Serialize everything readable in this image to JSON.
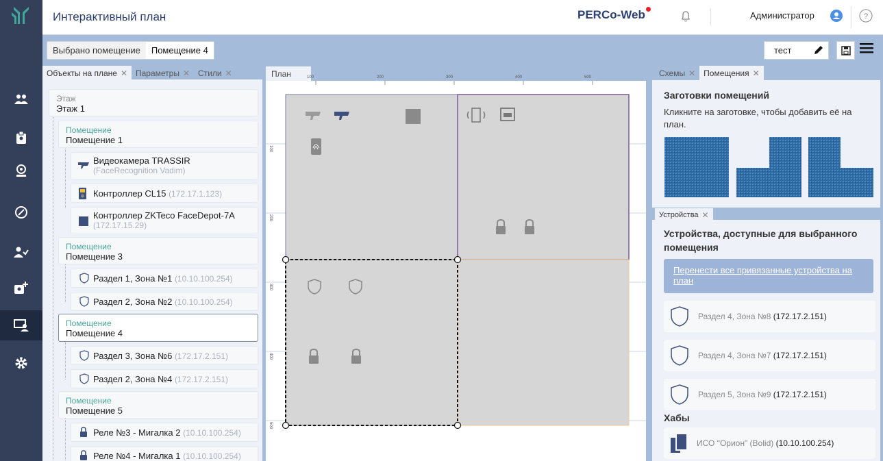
{
  "header": {
    "title": "Интерактивный план",
    "brand": "PERCo-Web",
    "user": "Администратор"
  },
  "toolbar": {
    "selected_label": "Выбрано помещение",
    "selected_value": "Помещение 4",
    "scheme_value": "тест"
  },
  "left_tabs": [
    "Объекты на плане",
    "Параметры",
    "Стили"
  ],
  "tree": {
    "floor_label": "Этаж",
    "floor_name": "Этаж 1",
    "room_label": "Помещение",
    "room1": "Помещение 1",
    "cam_name": "Видеокамера TRASSIR",
    "cam_sub": "(FaceRecognition Vadim)",
    "ctrl1_name": "Контроллер CL15",
    "ctrl1_ip": "(172.17.1.123)",
    "ctrl2_name": "Контроллер ZKTeco FaceDepot-7A",
    "ctrl2_ip": "(172.17.15.29)",
    "room3": "Помещение 3",
    "z1_name": "Раздел 1, Зона №1",
    "z1_ip": "(10.10.100.254)",
    "z2_name": "Раздел 2, Зона №2",
    "z2_ip": "(10.10.100.254)",
    "room4": "Помещение 4",
    "z6_name": "Раздел 3, Зона №6",
    "z6_ip": "(172.17.2.151)",
    "z4_name": "Раздел 2, Зона №4",
    "z4_ip": "(172.17.2.151)",
    "room5": "Помещение 5",
    "r3_name": "Реле №3 - Мигалка 2",
    "r3_ip": "(10.10.100.254)",
    "r4_name": "Реле №4 - Мигалка 1",
    "r4_ip": "(10.10.100.254)"
  },
  "plan": {
    "tab": "План",
    "ruler_x": [
      "100",
      "200",
      "300",
      "400",
      "500"
    ],
    "ruler_y": [
      "100",
      "200",
      "300",
      "400",
      "500"
    ]
  },
  "right": {
    "tabs": [
      "Схемы",
      "Помещения"
    ],
    "templates_title": "Заготовки помещений",
    "templates_hint": "Кликните на заготовке, чтобы добавить её на план.",
    "devices_tab": "Устройства",
    "devices_title": "Устройства, доступные для выбранного помещения",
    "move_all": "Перенести все привязанные устройства на план",
    "devices": [
      {
        "name": "Раздел 4, Зона №8",
        "ip": "(172.17.2.151)"
      },
      {
        "name": "Раздел 4, Зона №7",
        "ip": "(172.17.2.151)"
      },
      {
        "name": "Раздел 5, Зона №9",
        "ip": "(172.17.2.151)"
      }
    ],
    "hubs_title": "Хабы",
    "hub": {
      "name": "ИСО \"Орион\" (Bolid)",
      "ip": "(10.10.100.254)"
    }
  },
  "colors": {
    "sidebar": "#34405a",
    "panel": "#a4bbd9",
    "accent": "#2e3f6e",
    "teal": "#4aa59a"
  }
}
